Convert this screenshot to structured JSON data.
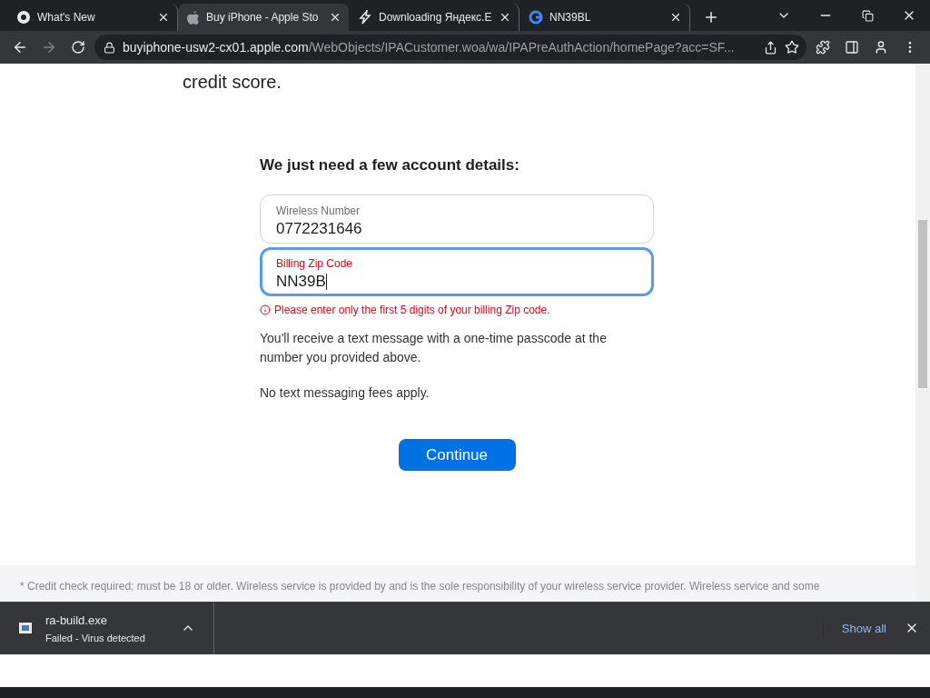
{
  "tabs": [
    {
      "title": "What's New",
      "selected": false
    },
    {
      "title": "Buy iPhone - Apple Sto",
      "selected": true
    },
    {
      "title": "Downloading Яндекс.E",
      "selected": false
    },
    {
      "title": "NN39BL",
      "selected": false
    }
  ],
  "address_bar": {
    "host": "buyiphone-usw2-cx01.apple.com",
    "path": "/WebObjects/IPACustomer.woa/wa/IPAPreAuthAction/homePage?acc=SF..."
  },
  "page": {
    "intro_tail": "credit score.",
    "heading": "We just need a few account details:",
    "fields": [
      {
        "label": "Wireless Number",
        "value": "0772231646",
        "focused": false,
        "error": false
      },
      {
        "label": "Billing Zip Code",
        "value": "NN39B",
        "focused": true,
        "error": true
      }
    ],
    "error_message": "Please enter only the first 5 digits of your billing Zip code.",
    "notes": [
      "You'll receive a text message with a one-time passcode at the number you provided above.",
      "No text messaging fees apply."
    ],
    "button": "Continue",
    "footnote": "* Credit check required; must be 18 or older. Wireless service is provided by and is the sole responsibility of your wireless service provider. Wireless service and some"
  },
  "download_bar": {
    "file": "ra-build.exe",
    "status": "Failed - Virus detected",
    "show_all": "Show all"
  }
}
